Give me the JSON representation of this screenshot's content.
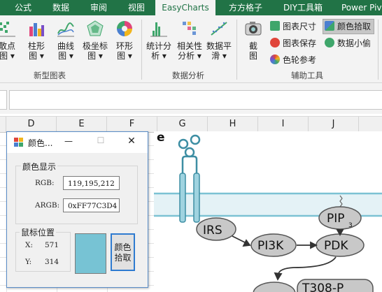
{
  "ribbon": {
    "tabs": [
      {
        "label": "公式",
        "active": false
      },
      {
        "label": "数据",
        "active": false
      },
      {
        "label": "审阅",
        "active": false
      },
      {
        "label": "视图",
        "active": false
      },
      {
        "label": "EasyCharts",
        "active": true
      },
      {
        "label": "方方格子",
        "active": false
      },
      {
        "label": "DIY工具箱",
        "active": false
      },
      {
        "label": "Power Piv",
        "active": false
      }
    ],
    "groups": {
      "new_charts": {
        "label": "新型图表",
        "buttons": [
          {
            "line1": "散点",
            "line2": "图 ▾"
          },
          {
            "line1": "柱形",
            "line2": "图 ▾"
          },
          {
            "line1": "曲线",
            "line2": "图 ▾"
          },
          {
            "line1": "极坐标",
            "line2": "图 ▾"
          },
          {
            "line1": "环形",
            "line2": "图 ▾"
          }
        ]
      },
      "data_analysis": {
        "label": "数据分析",
        "buttons": [
          {
            "line1": "统计分",
            "line2": "析 ▾"
          },
          {
            "line1": "相关性",
            "line2": "分析 ▾"
          },
          {
            "line1": "数据平",
            "line2": "滑 ▾"
          }
        ]
      },
      "tools": {
        "label": "辅助工具",
        "screenshot": {
          "line1": "截",
          "line2": "图"
        },
        "chart_size": "图表尺寸",
        "chart_save": "图表保存",
        "color_ref": "色轮参考",
        "color_pick": "颜色拾取",
        "data_thief": "数据小偷"
      }
    }
  },
  "columns": [
    "D",
    "E",
    "F",
    "G",
    "H",
    "I",
    "J"
  ],
  "figure": {
    "panel_letter": "e",
    "nodes": {
      "irs": "IRS",
      "pi3k": "PI3K",
      "pdk": "PDK",
      "pip": "PIP",
      "pip_sub": "3",
      "t308": "T308-P"
    }
  },
  "dialog": {
    "title": "颜色...",
    "minimize": "—",
    "maximize": "☐",
    "close": "✕",
    "color_display_legend": "颜色显示",
    "rgb_label": "RGB:",
    "rgb_value": "119,195,212",
    "argb_label": "ARGB:",
    "argb_value": "0xFF77C3D4",
    "mouse_pos_legend": "鼠标位置",
    "x_label": "X:",
    "x_value": "571",
    "y_label": "Y:",
    "y_value": "314",
    "picked_color": "#77C3D4",
    "pick_button_line1": "颜色",
    "pick_button_line2": "拾取"
  },
  "colors": {
    "excel_green": "#217346",
    "membrane": "#7cc2d3",
    "node_fill": "#c8c8c8"
  }
}
